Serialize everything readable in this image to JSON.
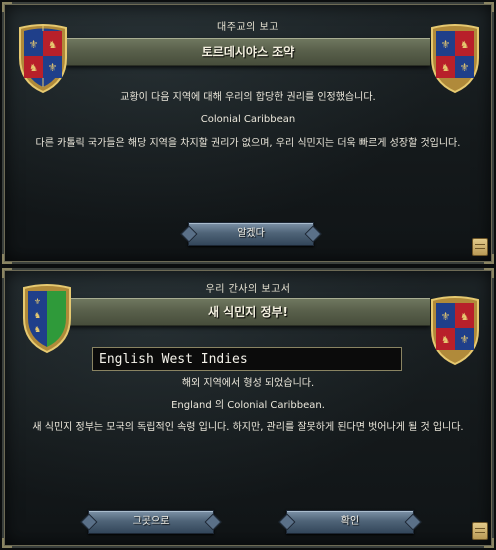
{
  "top_dialog": {
    "header": "대주교의 보고",
    "title": "토르데시야스 조약",
    "line1": "교황이 다음 지역에 대해 우리의 합당한 권리를 인정했습니다.",
    "line2": "Colonial Caribbean",
    "line3": "다른 카톨릭 국가들은 해당 지역을 차지할 권리가 없으며, 우리 식민지는 더욱 빠르게 성장할 것입니다.",
    "ok_label": "알겠다"
  },
  "bottom_dialog": {
    "header": "우리 간사의 보고서",
    "title": "새 식민지 정부!",
    "name_value": "English West Indies",
    "line1": "해외 지역에서 형성 되었습니다.",
    "line2": "England 의 Colonial Caribbean.",
    "line3": "새 식민지 정부는 모국의 독립적인 속령 입니다. 하지만, 관리를 잘못하게 된다면 벗어나게 될 것 입니다.",
    "cancel_label": "그곳으로",
    "confirm_label": "확인"
  },
  "colors": {
    "banner": "#59604b",
    "button": "#4f6478",
    "panel": "#151a1c",
    "gold_border": "#8a8462"
  },
  "icons": [
    "england-shield-icon",
    "new-colony-shield-icon",
    "scroll-icon"
  ]
}
